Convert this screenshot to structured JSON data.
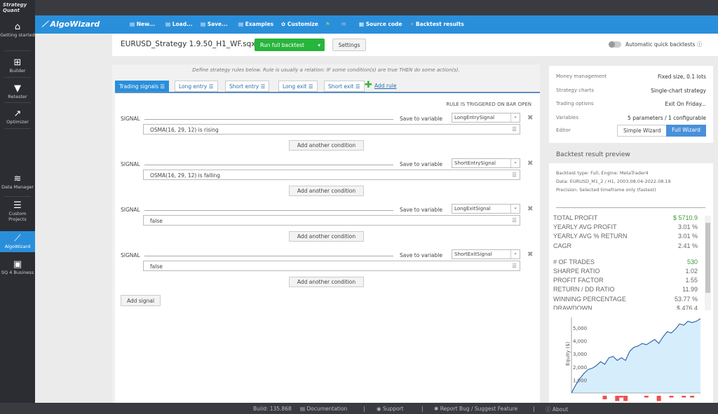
{
  "sidebar": {
    "logo": "Strategy Quant",
    "items": [
      {
        "label": "Getting started",
        "icon": "home-icon"
      },
      {
        "label": "Builder",
        "icon": "plus-icon"
      },
      {
        "label": "Retester",
        "icon": "filter-icon"
      },
      {
        "label": "Optimizer",
        "icon": "chart-icon"
      },
      {
        "label": "Data Manager",
        "icon": "database-icon"
      },
      {
        "label": "Custom Projects",
        "icon": "projects-icon"
      },
      {
        "label": "AlgoWizard",
        "icon": "wand-icon",
        "active": true
      },
      {
        "label": "SQ 4 Business",
        "icon": "briefcase-icon"
      }
    ]
  },
  "toolbar": {
    "brand": "AlgoWizard",
    "new": "New...",
    "load": "Load...",
    "save": "Save...",
    "examples": "Examples",
    "customize": "Customize",
    "source_code": "Source code",
    "backtest_results": "Backtest results"
  },
  "header": {
    "filename": "EURUSD_Strategy 1.9.50_H1_WF.sqx",
    "run_label": "Run full backtest",
    "settings_label": "Settings",
    "auto_label": "Automatic quick backtests",
    "auto_enabled": false
  },
  "rules": {
    "hint": "Define strategy rules below. Rule is usually a relation: IF some condition(s) are true THEN do some action(s).",
    "tabs": [
      "Trading signals",
      "Long entry",
      "Short entry",
      "Long exit",
      "Short exit"
    ],
    "active_tab": "Trading signals",
    "add_rule": "Add rule",
    "trigger": "RULE IS TRIGGERED ON BAR OPEN",
    "signal_label": "SIGNAL",
    "save_to_variable": "Save to variable",
    "add_condition": "Add another condition",
    "add_signal": "Add signal",
    "signals": [
      {
        "condition": "OSMA(16, 29, 12) is rising",
        "variable": "LongEntrySignal"
      },
      {
        "condition": "OSMA(16, 29, 12) is falling",
        "variable": "ShortEntrySignal"
      },
      {
        "condition": "false",
        "variable": "LongExitSignal"
      },
      {
        "condition": "false",
        "variable": "ShortExitSignal"
      }
    ]
  },
  "info": {
    "rows": [
      {
        "k": "Money management",
        "v": "Fixed size, 0.1 lots"
      },
      {
        "k": "Strategy charts",
        "v": "Single-chart strategy"
      },
      {
        "k": "Trading options",
        "v": "Exit On Friday..."
      },
      {
        "k": "Variables",
        "v": "5 parameters / 1 configurable"
      }
    ],
    "editor_label": "Editor",
    "simple": "Simple Wizard",
    "full": "Full Wizard"
  },
  "backtest": {
    "title": "Backtest result preview",
    "type": "Backtest type: Full, Engine: MetaTrader4",
    "data": "Data: EURUSD_M1_2 / H1, 2003.08.04-2022.08.19",
    "precision": "Precision: Selected timeframe only (fastest)",
    "stats": [
      {
        "k": "TOTAL PROFIT",
        "v": "$ 5710.9",
        "green": true
      },
      {
        "k": "YEARLY AVG PROFIT",
        "v": "3.01 %"
      },
      {
        "k": "YEARLY AVG % RETURN",
        "v": "3.01 %"
      },
      {
        "k": "CAGR",
        "v": "2.41 %"
      },
      {
        "k": "# OF TRADES",
        "v": "530",
        "green": true,
        "gap": true
      },
      {
        "k": "SHARPE RATIO",
        "v": "1.02"
      },
      {
        "k": "PROFIT FACTOR",
        "v": "1.55"
      },
      {
        "k": "RETURN / DD RATIO",
        "v": "11.99"
      },
      {
        "k": "WINNING PERCENTAGE",
        "v": "53.77 %"
      },
      {
        "k": "DRAWDOWN",
        "v": "$ 476.4"
      }
    ]
  },
  "chart_data": {
    "type": "area",
    "ylabel": "Equity ($)",
    "yticks": [
      "1,000",
      "2,000",
      "3,000",
      "4,000",
      "5,000"
    ],
    "ylim": [
      0,
      5800
    ],
    "values": [
      0,
      600,
      1100,
      1500,
      1800,
      1900,
      2100,
      2400,
      2200,
      2700,
      2800,
      2500,
      2700,
      2500,
      3200,
      3500,
      3600,
      3800,
      3700,
      3900,
      4100,
      3800,
      4300,
      4700,
      4600,
      4900,
      5300,
      5200,
      5500,
      5400,
      5500,
      5700
    ],
    "colors": {
      "line": "#3b66b0",
      "fill": "#d6eefb",
      "drawdown": "#f05050"
    }
  },
  "footer": {
    "build": "Build: 135.868",
    "docs": "Documentation",
    "support": "Support",
    "report": "Report Bug / Suggest Feature",
    "about": "About"
  }
}
